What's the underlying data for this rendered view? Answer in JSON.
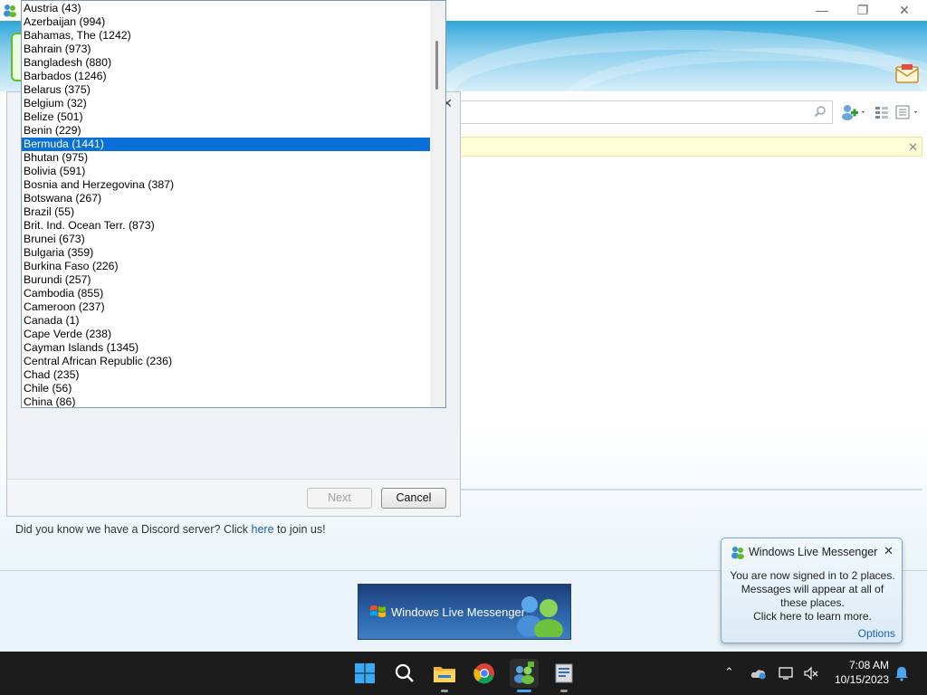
{
  "main_window": {
    "title": "",
    "controls": {
      "minimize": "—",
      "maximize": "❐",
      "close": "✕"
    }
  },
  "tip": {
    "prefix": "Did you know we have a Discord server? Click ",
    "link": "here",
    "suffix": " to join us!"
  },
  "banner": {
    "text": "Windows Live Messenger"
  },
  "wizard": {
    "close": "✕",
    "next_button": "Next",
    "cancel_button": "Cancel"
  },
  "country_list": {
    "selected": "Bermuda (1441)",
    "items": [
      "Austria (43)",
      "Azerbaijan (994)",
      "Bahamas, The (1242)",
      "Bahrain (973)",
      "Bangladesh (880)",
      "Barbados (1246)",
      "Belarus (375)",
      "Belgium (32)",
      "Belize (501)",
      "Benin (229)",
      "Bermuda (1441)",
      "Bhutan (975)",
      "Bolivia (591)",
      "Bosnia and Herzegovina (387)",
      "Botswana (267)",
      "Brazil (55)",
      "Brit. Ind. Ocean Terr. (873)",
      "Brunei (673)",
      "Bulgaria (359)",
      "Burkina Faso (226)",
      "Burundi (257)",
      "Cambodia (855)",
      "Cameroon (237)",
      "Canada (1)",
      "Cape Verde (238)",
      "Cayman Islands (1345)",
      "Central African Republic (236)",
      "Chad (235)",
      "Chile (56)",
      "China (86)"
    ]
  },
  "notification": {
    "title": "Windows Live Messenger",
    "close": "✕",
    "line1": "You are now signed in to 2 places.",
    "line2": "Messages will appear at all of these places.",
    "line3": "Click here to learn more.",
    "options_link": "Options"
  },
  "taskbar": {
    "icons": [
      "windows-start-icon",
      "search-icon",
      "file-explorer-icon",
      "chrome-icon",
      "messenger-icon",
      "app-installer-icon"
    ],
    "clock_time": "7:08 AM",
    "clock_date": "10/15/2023"
  },
  "colors": {
    "selection": "#0a6fd6",
    "taskbar": "#1c1c1c",
    "link": "#1a5fb4",
    "notice": "#fffdd6"
  }
}
